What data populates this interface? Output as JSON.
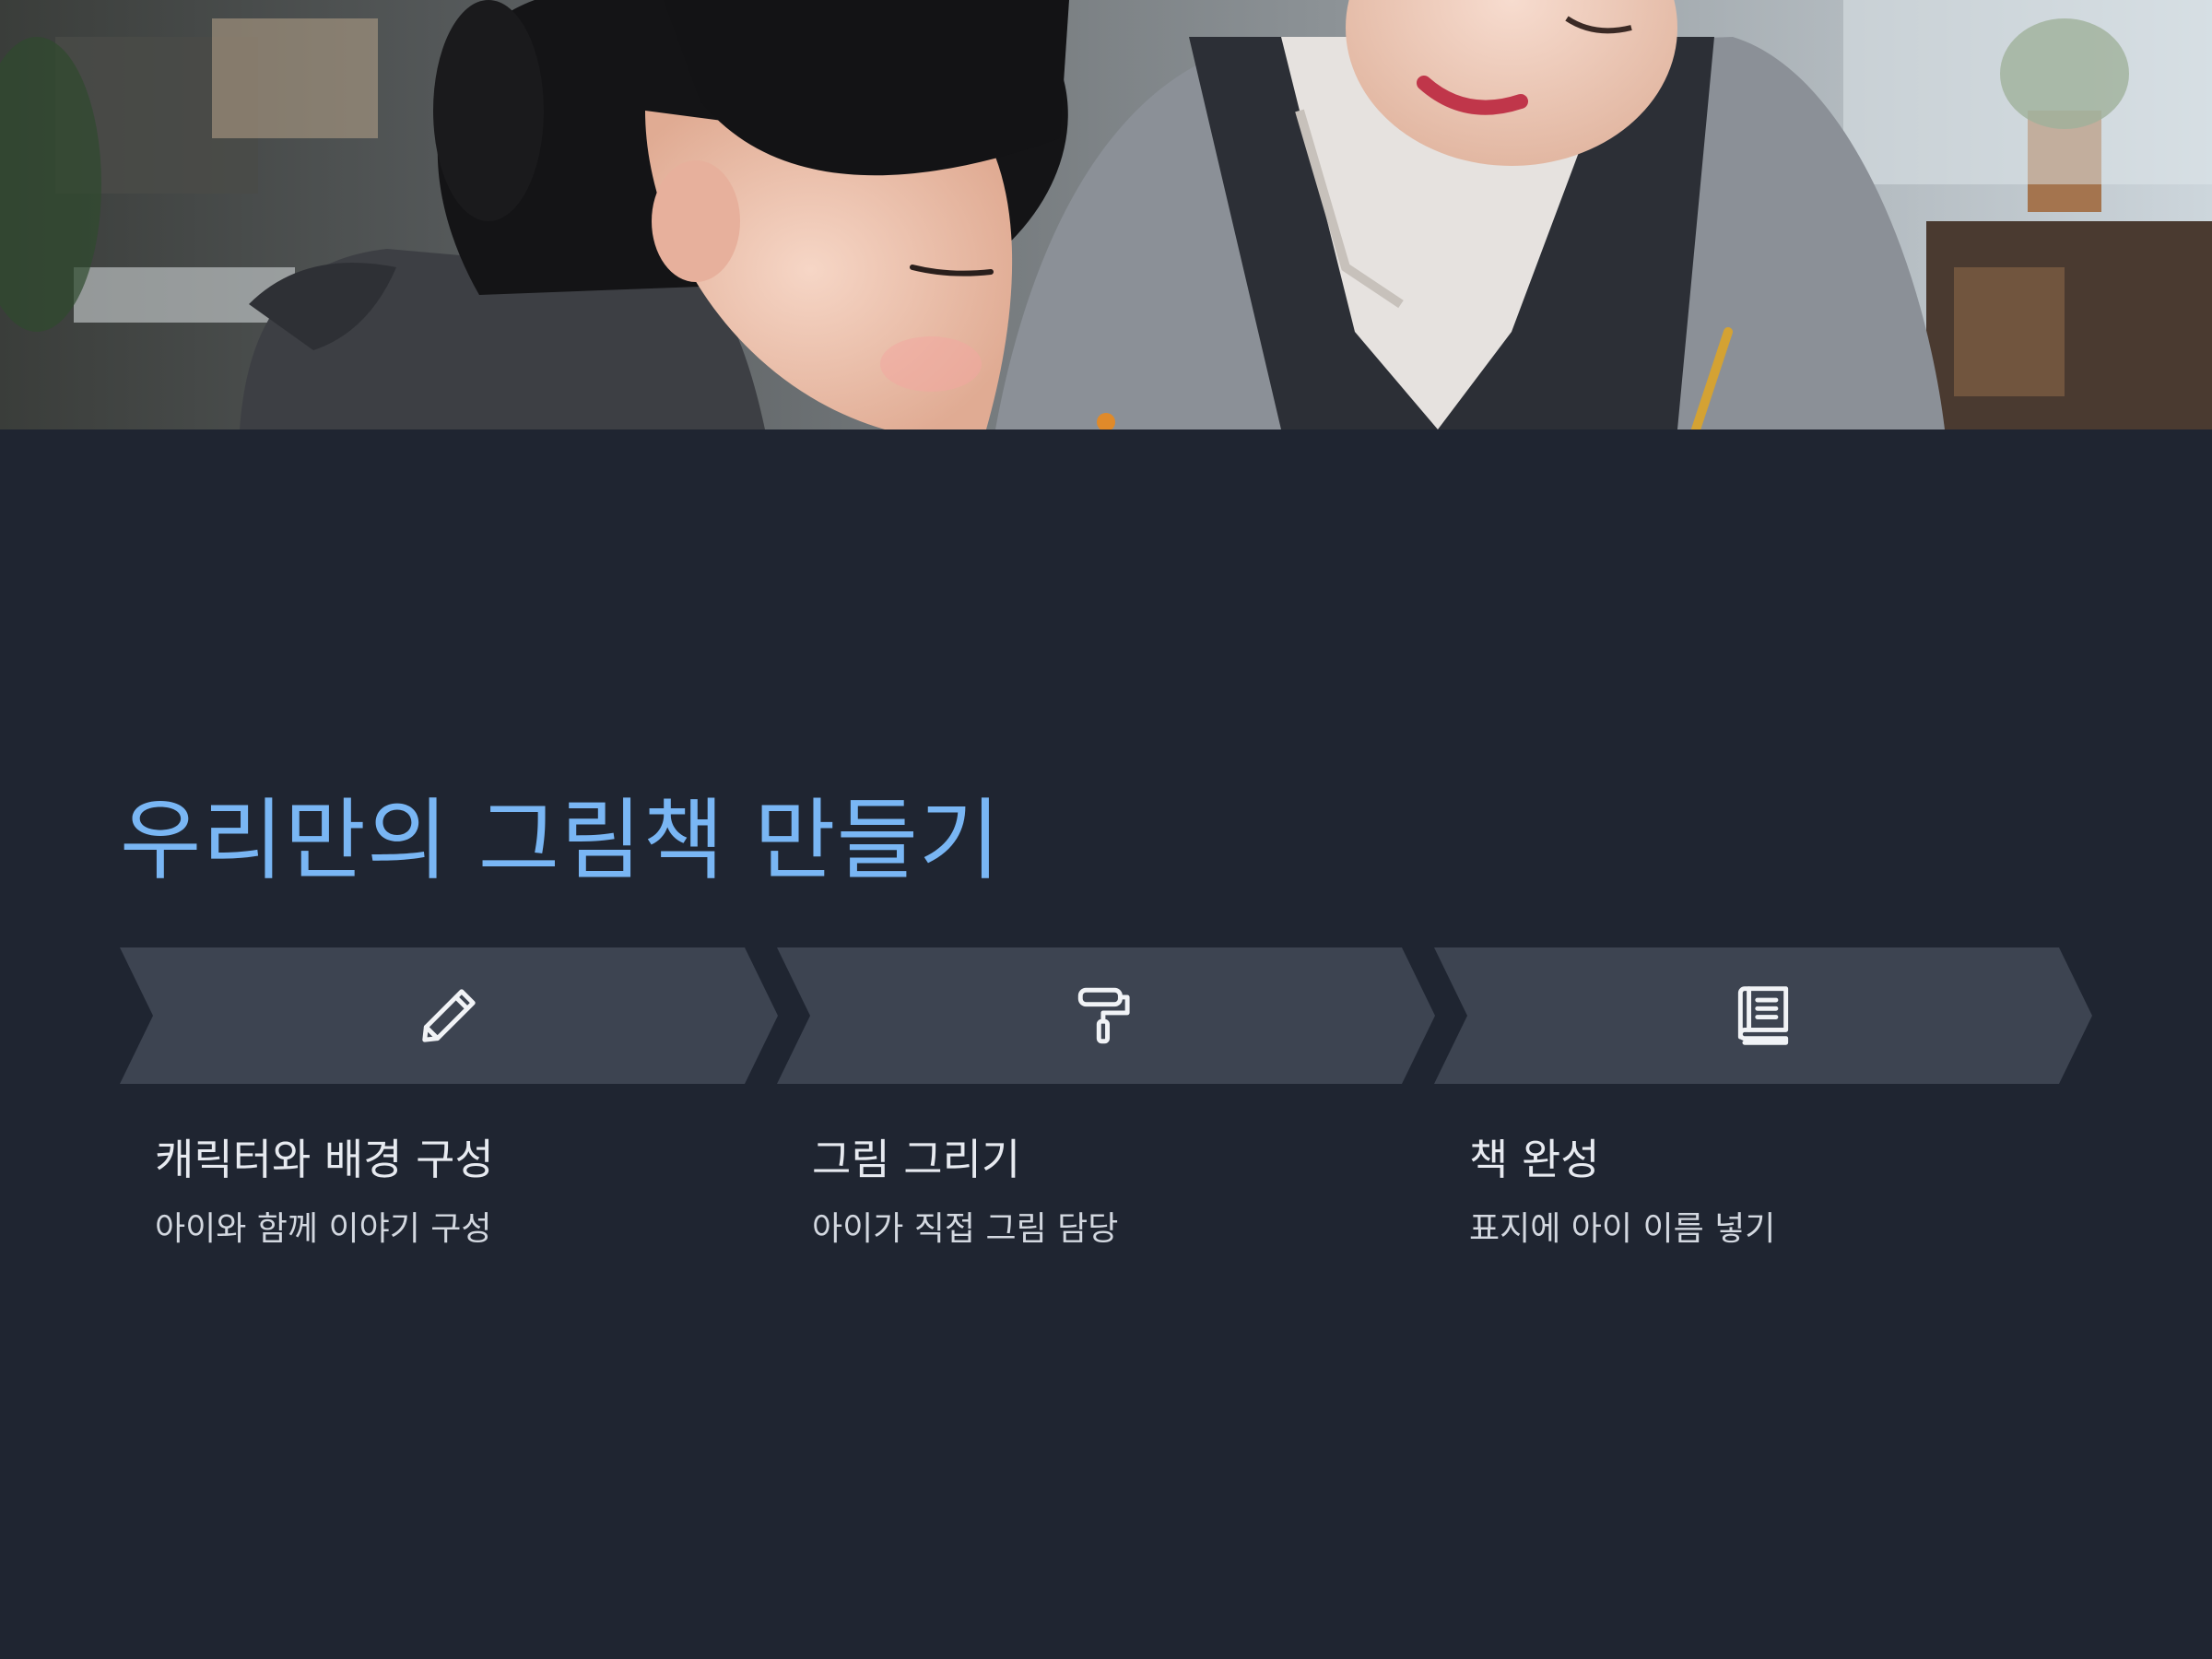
{
  "colors": {
    "background": "#1f2531",
    "title": "#79b6f4",
    "chevron": "#3d4451",
    "step_title": "#e7eaf0",
    "step_desc": "#d3d8e0",
    "icon_stroke": "#f1f3f6"
  },
  "hero": {
    "image_description": "photo of a young girl with a ponytail drawing at a table next to a smiling woman in an apron"
  },
  "title": "우리만의 그림책 만들기",
  "steps": [
    {
      "icon": "pencil-icon",
      "title": "캐릭터와 배경 구성",
      "desc": "아이와 함께 이야기 구성"
    },
    {
      "icon": "paint-roller-icon",
      "title": "그림 그리기",
      "desc": "아이가 직접 그림 담당"
    },
    {
      "icon": "book-icon",
      "title": "책 완성",
      "desc": "표지에 아이 이름 넣기"
    }
  ]
}
